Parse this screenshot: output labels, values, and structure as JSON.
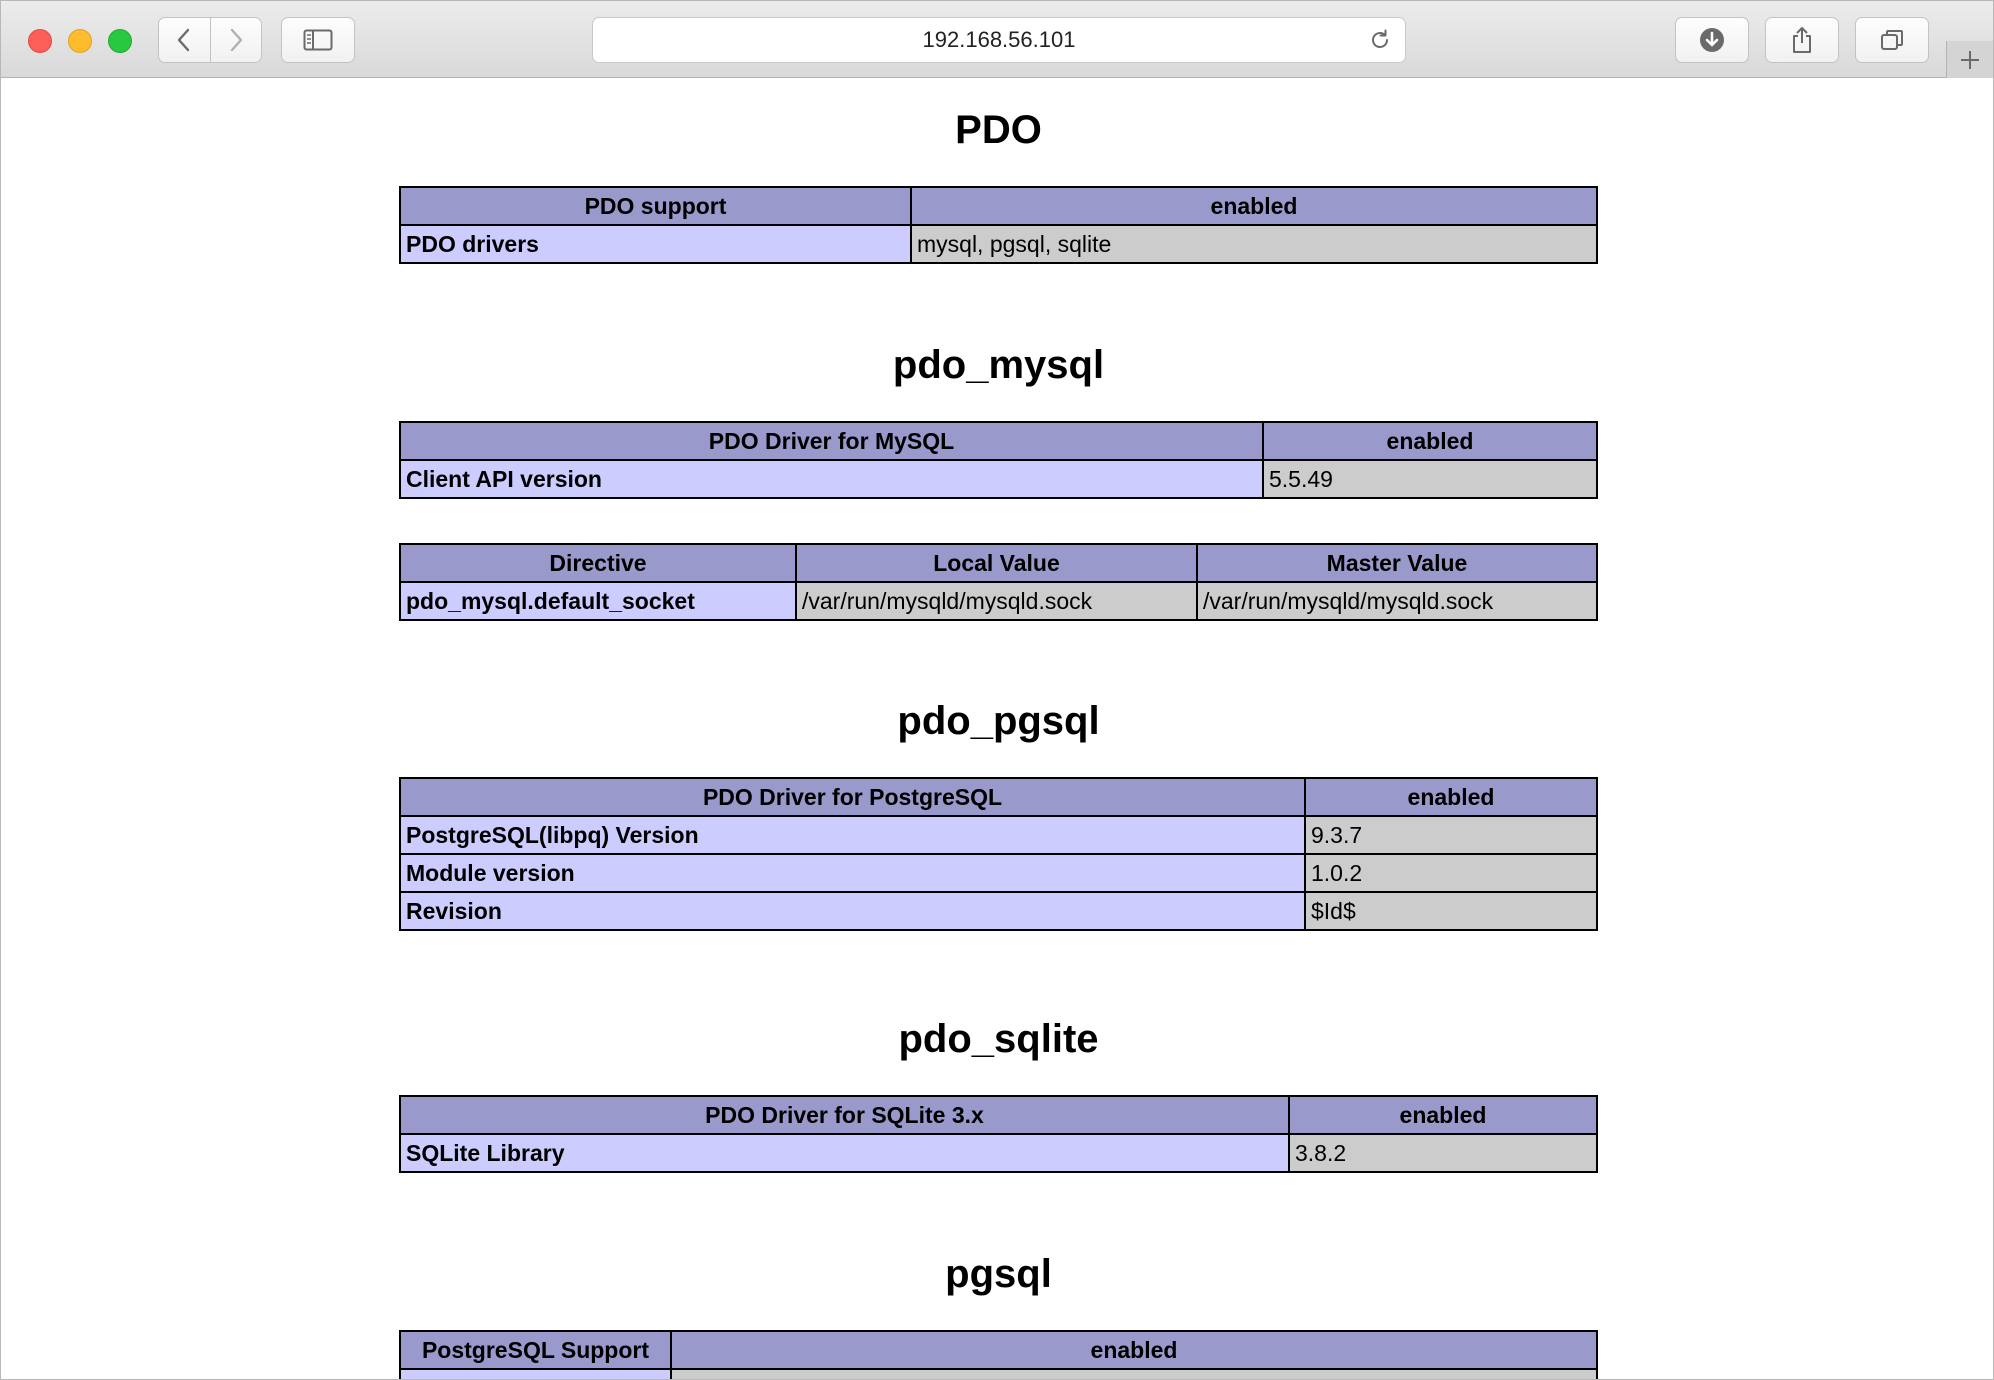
{
  "browser": {
    "url": "192.168.56.101",
    "icons": {
      "back": "chevron-left-icon",
      "forward": "chevron-right-icon",
      "sidebar": "sidebar-icon",
      "reload": "reload-icon",
      "downloads": "download-icon",
      "share": "share-icon",
      "tabs": "tabs-icon",
      "new_tab": "plus-icon"
    }
  },
  "colors": {
    "header_bg": "#9999cc",
    "key_bg": "#ccccff",
    "value_bg": "#cccccc"
  },
  "sections": {
    "pdo": {
      "title": "PDO",
      "table": {
        "header": [
          "PDO support",
          "enabled"
        ],
        "rows": [
          [
            "PDO drivers",
            "mysql, pgsql, sqlite"
          ]
        ]
      }
    },
    "pdo_mysql": {
      "title": "pdo_mysql",
      "table": {
        "header": [
          "PDO Driver for MySQL",
          "enabled"
        ],
        "rows": [
          [
            "Client API version",
            "5.5.49"
          ]
        ]
      },
      "directives": {
        "header": [
          "Directive",
          "Local Value",
          "Master Value"
        ],
        "rows": [
          [
            "pdo_mysql.default_socket",
            "/var/run/mysqld/mysqld.sock",
            "/var/run/mysqld/mysqld.sock"
          ]
        ]
      }
    },
    "pdo_pgsql": {
      "title": "pdo_pgsql",
      "table": {
        "header": [
          "PDO Driver for PostgreSQL",
          "enabled"
        ],
        "rows": [
          [
            "PostgreSQL(libpq) Version",
            "9.3.7"
          ],
          [
            "Module version",
            "1.0.2"
          ],
          [
            "Revision",
            "$Id$"
          ]
        ]
      }
    },
    "pdo_sqlite": {
      "title": "pdo_sqlite",
      "table": {
        "header": [
          "PDO Driver for SQLite 3.x",
          "enabled"
        ],
        "rows": [
          [
            "SQLite Library",
            "3.8.2"
          ]
        ]
      }
    },
    "pgsql": {
      "title": "pgsql",
      "table": {
        "header": [
          "PostgreSQL Support",
          "enabled"
        ]
      }
    }
  }
}
